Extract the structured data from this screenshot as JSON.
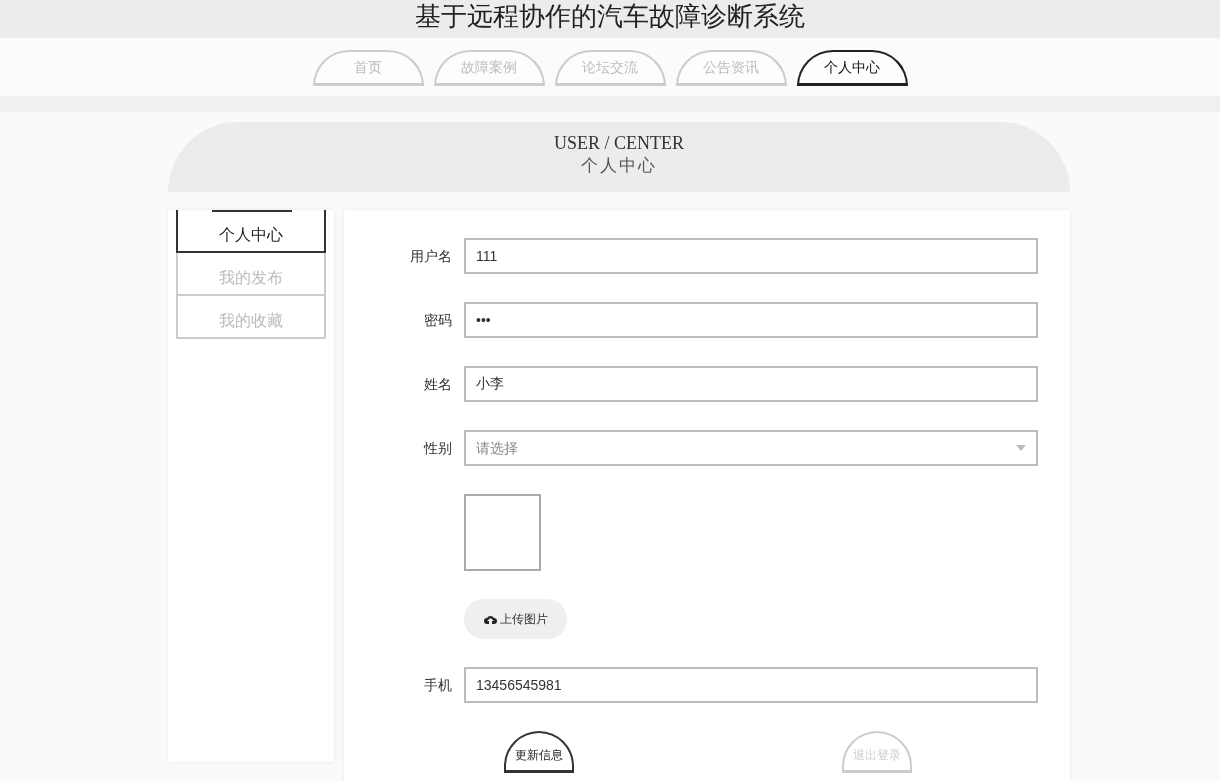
{
  "site_title": "基于远程协作的汽车故障诊断系统",
  "nav_tabs": [
    {
      "label": "首页",
      "selected": false
    },
    {
      "label": "故障案例",
      "selected": false
    },
    {
      "label": "论坛交流",
      "selected": false
    },
    {
      "label": "公告资讯",
      "selected": false
    },
    {
      "label": "个人中心",
      "selected": true
    }
  ],
  "banner": {
    "title_en": "USER / CENTER",
    "title_cn": "个人中心"
  },
  "sidebar": {
    "items": [
      {
        "label": "个人中心",
        "selected": true
      },
      {
        "label": "我的发布",
        "selected": false
      },
      {
        "label": "我的收藏",
        "selected": false
      }
    ]
  },
  "form": {
    "fields": [
      {
        "kind": "text",
        "label": "用户名",
        "value": "111"
      },
      {
        "kind": "text",
        "label": "密码",
        "value": "•••"
      },
      {
        "kind": "text",
        "label": "姓名",
        "value": "小李"
      },
      {
        "kind": "select",
        "label": "性别",
        "placeholder": "请选择"
      },
      {
        "kind": "image",
        "button": "上传图片"
      },
      {
        "kind": "text",
        "label": "手机",
        "value": "13456545981"
      }
    ],
    "buttons": [
      {
        "label": "更新信息",
        "kind": "primary"
      },
      {
        "label": "退出登录",
        "kind": "secondary"
      }
    ]
  }
}
